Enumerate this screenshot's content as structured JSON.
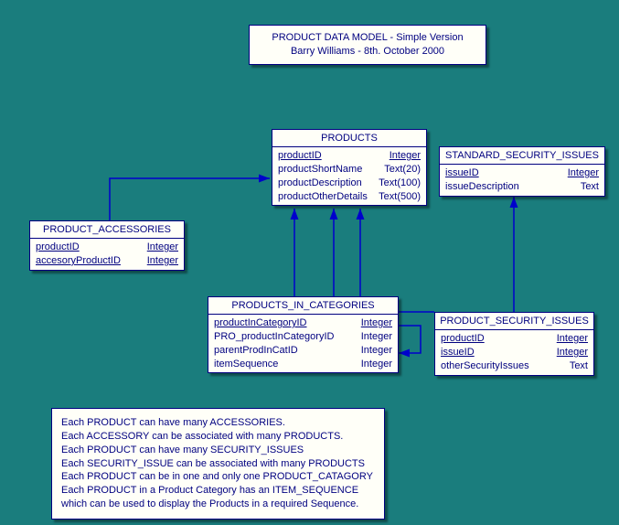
{
  "title": {
    "line1": "PRODUCT DATA MODEL - Simple Version",
    "line2": "Barry Williams - 8th. October 2000"
  },
  "entities": {
    "products": {
      "name": "PRODUCTS",
      "attrs": [
        {
          "name": "productID",
          "type": "Integer",
          "nameU": true,
          "typeU": true
        },
        {
          "name": "productShortName",
          "type": "Text(20)",
          "nameU": false,
          "typeU": false
        },
        {
          "name": "productDescription",
          "type": "Text(100)",
          "nameU": false,
          "typeU": false
        },
        {
          "name": "productOtherDetails",
          "type": "Text(500)",
          "nameU": false,
          "typeU": false
        }
      ]
    },
    "standard_security_issues": {
      "name": "STANDARD_SECURITY_ISSUES",
      "attrs": [
        {
          "name": "issueID",
          "type": "Integer",
          "nameU": true,
          "typeU": true
        },
        {
          "name": "issueDescription",
          "type": "Text",
          "nameU": false,
          "typeU": false
        }
      ]
    },
    "product_accessories": {
      "name": "PRODUCT_ACCESSORIES",
      "attrs": [
        {
          "name": "productID",
          "type": "Integer",
          "nameU": true,
          "typeU": true
        },
        {
          "name": "accesoryProductID",
          "type": "Integer",
          "nameU": true,
          "typeU": true
        }
      ]
    },
    "products_in_categories": {
      "name": "PRODUCTS_IN_CATEGORIES",
      "attrs": [
        {
          "name": "productInCategoryID",
          "type": "Integer",
          "nameU": true,
          "typeU": true
        },
        {
          "name": "PRO_productInCategoryID",
          "type": "Integer",
          "nameU": false,
          "typeU": false
        },
        {
          "name": "parentProdInCatID",
          "type": "Integer",
          "nameU": false,
          "typeU": false
        },
        {
          "name": "itemSequence",
          "type": "Integer",
          "nameU": false,
          "typeU": false
        }
      ]
    },
    "product_security_issues": {
      "name": "PRODUCT_SECURITY_ISSUES",
      "attrs": [
        {
          "name": "productID",
          "type": "Integer",
          "nameU": true,
          "typeU": true
        },
        {
          "name": "issueID",
          "type": "Integer",
          "nameU": true,
          "typeU": true
        },
        {
          "name": "otherSecurityIssues",
          "type": "Text",
          "nameU": false,
          "typeU": false
        }
      ]
    }
  },
  "notes": {
    "l1": "Each PRODUCT can have many ACCESSORIES.",
    "l2": "Each ACCESSORY can be associated with many PRODUCTS.",
    "l3": "Each PRODUCT can have many SECURITY_ISSUES",
    "l4": "Each SECURITY_ISSUE can be associated with many PRODUCTS",
    "l5": "Each PRODUCT can be in one and only one PRODUCT_CATAGORY",
    "l6": "Each PRODUCT in a Product Category has an ITEM_SEQUENCE",
    "l7": "which can be used to display the Products in a required Sequence."
  }
}
